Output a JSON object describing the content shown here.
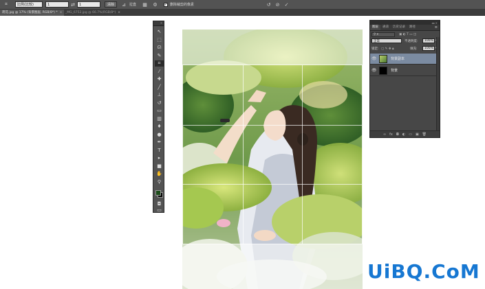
{
  "options_bar": {
    "tool_icon": "crop-tool-icon",
    "ratio_select": "比例(比较)",
    "width_value": "1",
    "height_value": "1",
    "clear_button": "清除",
    "straighten_label": "拉直",
    "overlay_icon": "grid-overlay-icon",
    "settings_icon": "gear-icon",
    "delete_cropped_label": "删除裁剪的像素",
    "delete_cropped_checked": true,
    "reset_icon": "reset-icon",
    "cancel_icon": "cancel-icon",
    "commit_icon": "check-icon"
  },
  "doc_tabs": [
    {
      "label": "荷花.jpg @ 17% (背景图层, RGB/8*) *",
      "active": true
    },
    {
      "label": "_MG_6752.jpg @ 66.7%(RGB/8*)",
      "active": false
    }
  ],
  "tools": [
    {
      "name": "move-tool",
      "glyph": "↖"
    },
    {
      "name": "marquee-tool",
      "glyph": "⬚"
    },
    {
      "name": "lasso-tool",
      "glyph": "ᘏ"
    },
    {
      "name": "quick-select-tool",
      "glyph": "✎"
    },
    {
      "name": "crop-tool",
      "glyph": "⌗",
      "active": true
    },
    {
      "name": "eyedropper-tool",
      "glyph": "⁄"
    },
    {
      "name": "healing-brush-tool",
      "glyph": "✚"
    },
    {
      "name": "brush-tool",
      "glyph": "╱"
    },
    {
      "name": "clone-stamp-tool",
      "glyph": "⊥"
    },
    {
      "name": "history-brush-tool",
      "glyph": "↺"
    },
    {
      "name": "eraser-tool",
      "glyph": "▭"
    },
    {
      "name": "gradient-tool",
      "glyph": "▥"
    },
    {
      "name": "blur-tool",
      "glyph": "♦"
    },
    {
      "name": "dodge-tool",
      "glyph": "●"
    },
    {
      "name": "pen-tool",
      "glyph": "✒"
    },
    {
      "name": "type-tool",
      "glyph": "T"
    },
    {
      "name": "path-select-tool",
      "glyph": "▸"
    },
    {
      "name": "shape-tool",
      "glyph": "■"
    },
    {
      "name": "hand-tool",
      "glyph": "✋"
    },
    {
      "name": "zoom-tool",
      "glyph": "⚲"
    }
  ],
  "colors": {
    "foreground": "#1d4d1a",
    "background": "#000000",
    "accent": "#7b8ba1",
    "watermark": "#1677d2"
  },
  "layers_panel": {
    "tabs": [
      "图层",
      "通道",
      "历史记录",
      "路径"
    ],
    "blend_mode": "正常",
    "opacity_label": "不透明度:",
    "opacity_value": "100%",
    "lock_label": "锁定:",
    "fill_label": "填充:",
    "fill_value": "100%",
    "layers": [
      {
        "name": "背景副本",
        "selected": true,
        "visible": true
      },
      {
        "name": "背景",
        "selected": false,
        "visible": true
      }
    ],
    "footer_icons": [
      "link-icon",
      "fx-icon",
      "mask-icon",
      "adjustment-icon",
      "group-icon",
      "new-layer-icon",
      "trash-icon"
    ]
  },
  "watermark": {
    "text": "UiBQ.CoM"
  }
}
